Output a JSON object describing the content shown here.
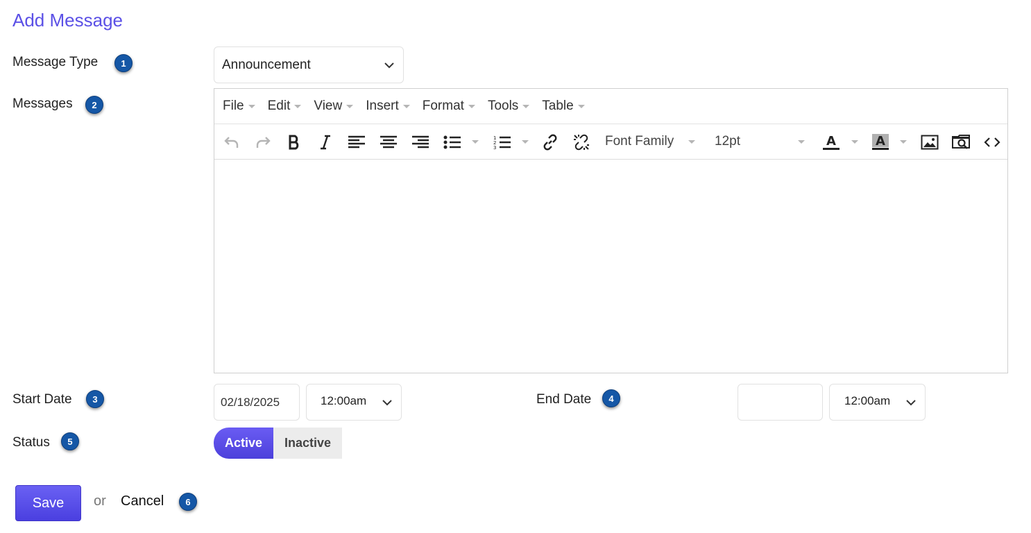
{
  "page": {
    "title": "Add Message"
  },
  "form": {
    "message_type": {
      "label": "Message Type",
      "badge": "1",
      "value": "Announcement"
    },
    "messages": {
      "label": "Messages",
      "badge": "2"
    },
    "start_date": {
      "label": "Start Date",
      "badge": "3",
      "date": "02/18/2025",
      "time": "12:00am"
    },
    "end_date": {
      "label": "End Date",
      "badge": "4",
      "date": "",
      "time": "12:00am"
    },
    "status": {
      "label": "Status",
      "badge": "5",
      "options": [
        "Active",
        "Inactive"
      ],
      "selected": "Active"
    }
  },
  "editor": {
    "menu": [
      "File",
      "Edit",
      "View",
      "Insert",
      "Format",
      "Tools",
      "Table"
    ],
    "font_family": "Font Family",
    "font_size": "12pt",
    "toolbar_icons": [
      "undo-icon",
      "redo-icon",
      "bold-icon",
      "italic-icon",
      "align-left-icon",
      "align-center-icon",
      "align-right-icon",
      "bullet-list-icon",
      "numbered-list-icon",
      "link-icon",
      "unlink-icon",
      "text-color-icon",
      "background-color-icon",
      "image-icon",
      "preview-icon",
      "code-icon"
    ],
    "content": ""
  },
  "actions": {
    "save_label": "Save",
    "or_text": "or",
    "cancel_label": "Cancel",
    "badge": "6"
  },
  "colors": {
    "accent": "#5b50e6",
    "badge": "#1557a6"
  }
}
